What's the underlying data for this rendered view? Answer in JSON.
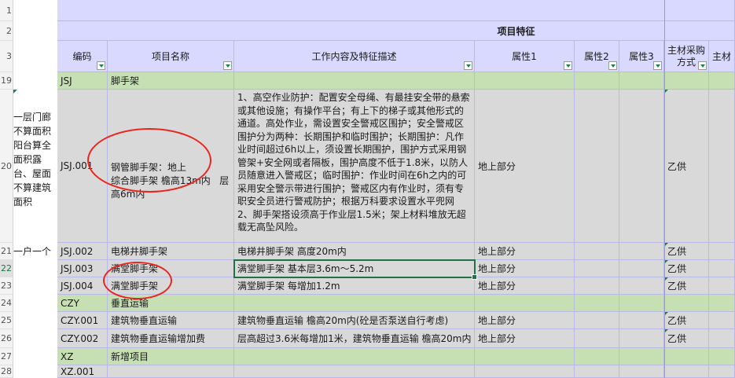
{
  "row_numbers": [
    "1",
    "2",
    "3",
    "19",
    "20",
    "21",
    "22",
    "23",
    "24",
    "25",
    "26",
    "27",
    "28"
  ],
  "left_notes": {
    "note1": "一层门廊不算面积阳台算全面积露台、屋面不算建筑面积",
    "note2": "一户一个"
  },
  "header": {
    "group_title": "项目特征",
    "columns": [
      "编码",
      "项目名称",
      "工作内容及特征描述",
      "属性1",
      "属性2",
      "属性3",
      "主材采购方式",
      "主材"
    ]
  },
  "rows": [
    {
      "code": "JSJ",
      "name": "脚手架",
      "desc": "",
      "attr1": "",
      "supply": ""
    },
    {
      "code": "JSJ.001",
      "name": "钢管脚手架：地上\n综合脚手架 檐高13m内   层高6m内",
      "desc": "1、高空作业防护：配置安全母绳、有最挂安全带的悬索或其他设施；有操作平台；有上下的梯子或其他形式的通道。高处作业，需设置安全警戒区围护；安全警戒区围护分为两种：长期围护和临时围护；长期围护：凡作业时间超过6h以上，须设置长期围护，围护方式采用钢管架+安全网或者隔板，围护高度不低于1.8米，以防人员随意进入警戒区；临时围护：作业时间在6h之内的可采用安全警示带进行围护；警戒区内有作业时，须有专职安全员进行警戒防护；根据万科要求设置水平兜网\n2、脚手架搭设须高于作业层1.5米；架上材料堆放无超载无高坠风险。",
      "attr1": "地上部分",
      "supply": "乙供"
    },
    {
      "code": "JSJ.002",
      "name": "电梯井脚手架",
      "desc": "电梯井脚手架 高度20m内",
      "attr1": "地上部分",
      "supply": "乙供"
    },
    {
      "code": "JSJ.003",
      "name": "满堂脚手架",
      "desc": "满堂脚手架 基本层3.6m～5.2m",
      "attr1": "地上部分",
      "supply": "乙供"
    },
    {
      "code": "JSJ.004",
      "name": "满堂脚手架",
      "desc": "满堂脚手架 每增加1.2m",
      "attr1": "地上部分",
      "supply": "乙供"
    },
    {
      "code": "CZY",
      "name": "垂直运输",
      "desc": "",
      "attr1": "",
      "supply": ""
    },
    {
      "code": "CZY.001",
      "name": "建筑物垂直运输",
      "desc": "建筑物垂直运输 檐高20m内(砼是否泵送自行考虑)",
      "attr1": "地上部分",
      "supply": "乙供"
    },
    {
      "code": "CZY.002",
      "name": "建筑物垂直运输增加费",
      "desc": "层高超过3.6米每增加1米，建筑物垂直运输 檐高20m内",
      "attr1": "地上部分",
      "supply": "乙供"
    },
    {
      "code": "XZ",
      "name": "新增项目",
      "desc": "",
      "attr1": "",
      "supply": ""
    },
    {
      "code": "XZ.001",
      "name": "",
      "desc": "",
      "attr1": "",
      "supply": ""
    }
  ]
}
